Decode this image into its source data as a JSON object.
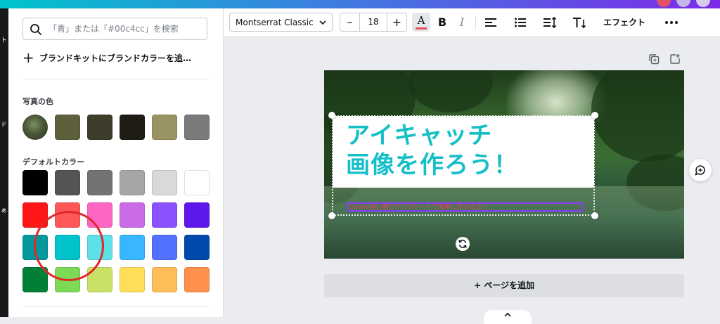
{
  "left_rail": {
    "labels": [
      "ト",
      "ド",
      "ぁ"
    ]
  },
  "color_panel": {
    "search": {
      "placeholder": "「青」または「#00c4cc」を検索",
      "value": ""
    },
    "add_brand_label": "ブランドキットにブランドカラーを追…",
    "photo_colors": {
      "title": "写真の色",
      "swatches": [
        "#5e603c",
        "#3e3c2a",
        "#1e1c14",
        "#9a9462",
        "#7a7a7a"
      ]
    },
    "default_colors": {
      "title": "デフォルトカラー",
      "rows": [
        [
          "#000000",
          "#545454",
          "#737373",
          "#a6a6a6",
          "#d9d9d9",
          "#ffffff"
        ],
        [
          "#ff1616",
          "#ff5757",
          "#ff66c4",
          "#cb6ce6",
          "#8c52ff",
          "#5e17eb"
        ],
        [
          "#03989e",
          "#00c2cb",
          "#5ce1e6",
          "#38b6ff",
          "#5271ff",
          "#004aad"
        ],
        [
          "#008037",
          "#7ed957",
          "#c9e265",
          "#ffde59",
          "#ffbd59",
          "#ff914d"
        ]
      ]
    }
  },
  "toolbar": {
    "font_family": "Montserrat Classic",
    "font_size": "18",
    "minus": "–",
    "plus": "+",
    "effect_label": "エフェクト",
    "text_color": "#e64f5c"
  },
  "design": {
    "title_line1": "アイキャッチ",
    "title_line2": "画像を作ろう！",
    "subtitle": "Canva初心者もテンプレートで簡単に作られる！",
    "title_color": "#15bfc8"
  },
  "add_page_label": "+ ページを追加"
}
